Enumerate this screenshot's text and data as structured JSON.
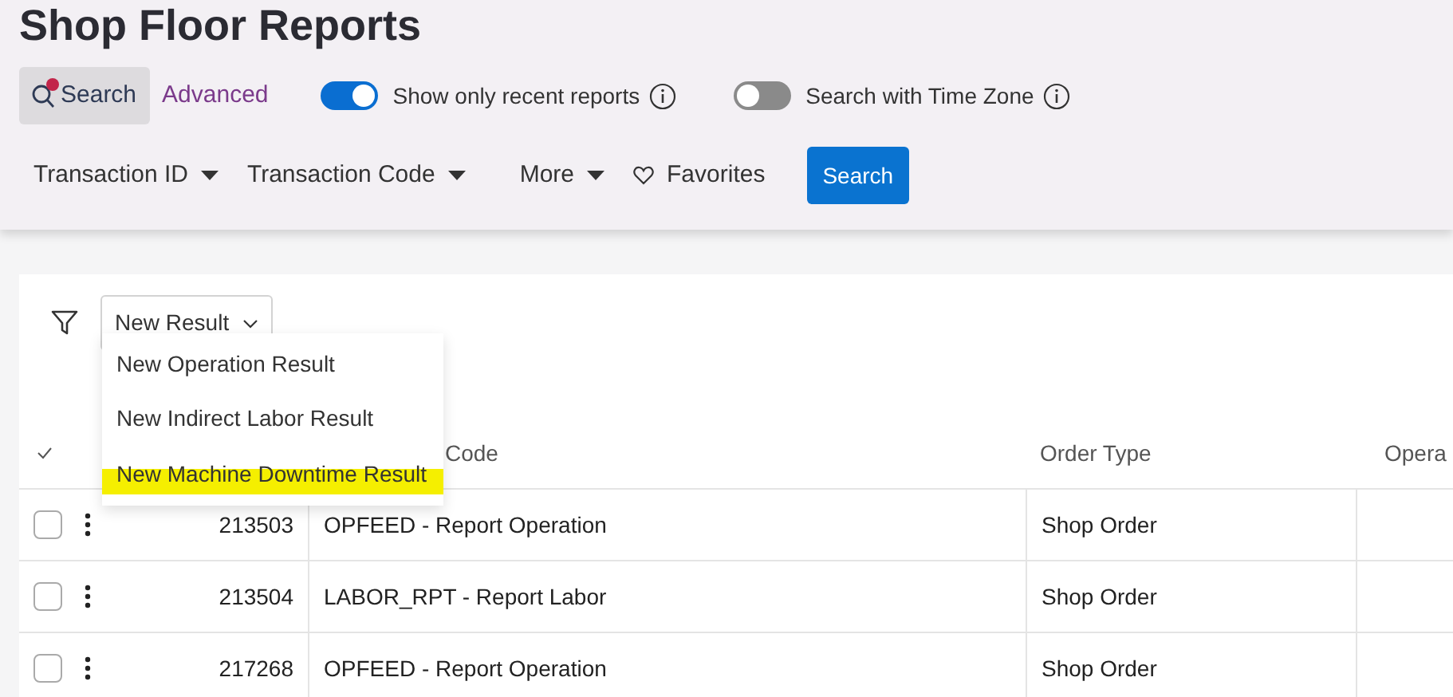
{
  "page_title": "Shop Floor Reports",
  "search_tabs": [
    {
      "label": "Search",
      "selected": true,
      "notification_dot": true
    },
    {
      "label": "Advanced",
      "selected": false
    }
  ],
  "toggles": [
    {
      "label": "Show only recent reports",
      "on": true
    },
    {
      "label": "Search with Time Zone",
      "on": false
    }
  ],
  "filters": [
    {
      "label": "Transaction ID",
      "kind": "dropdown"
    },
    {
      "label": "Transaction Code",
      "kind": "dropdown"
    },
    {
      "label": "More",
      "kind": "dropdown"
    },
    {
      "label": "Favorites",
      "kind": "favorites"
    }
  ],
  "search_button": "Search",
  "new_result": {
    "label": "New Result",
    "expanded": true,
    "menu": [
      {
        "label": "New Operation Result",
        "highlighted": false
      },
      {
        "label": "New Indirect Labor Result",
        "highlighted": false
      },
      {
        "label": "New Machine Downtime Result",
        "highlighted": true
      }
    ]
  },
  "table": {
    "columns": [
      "Code",
      "Order Type",
      "Opera"
    ],
    "rows": [
      {
        "checked": false,
        "id": "213503",
        "code": "OPFEED - Report Operation",
        "order_type": "Shop Order"
      },
      {
        "checked": false,
        "id": "213504",
        "code": "LABOR_RPT - Report Labor",
        "order_type": "Shop Order"
      },
      {
        "checked": false,
        "id": "217268",
        "code": "OPFEED - Report Operation",
        "order_type": "Shop Order"
      }
    ]
  }
}
